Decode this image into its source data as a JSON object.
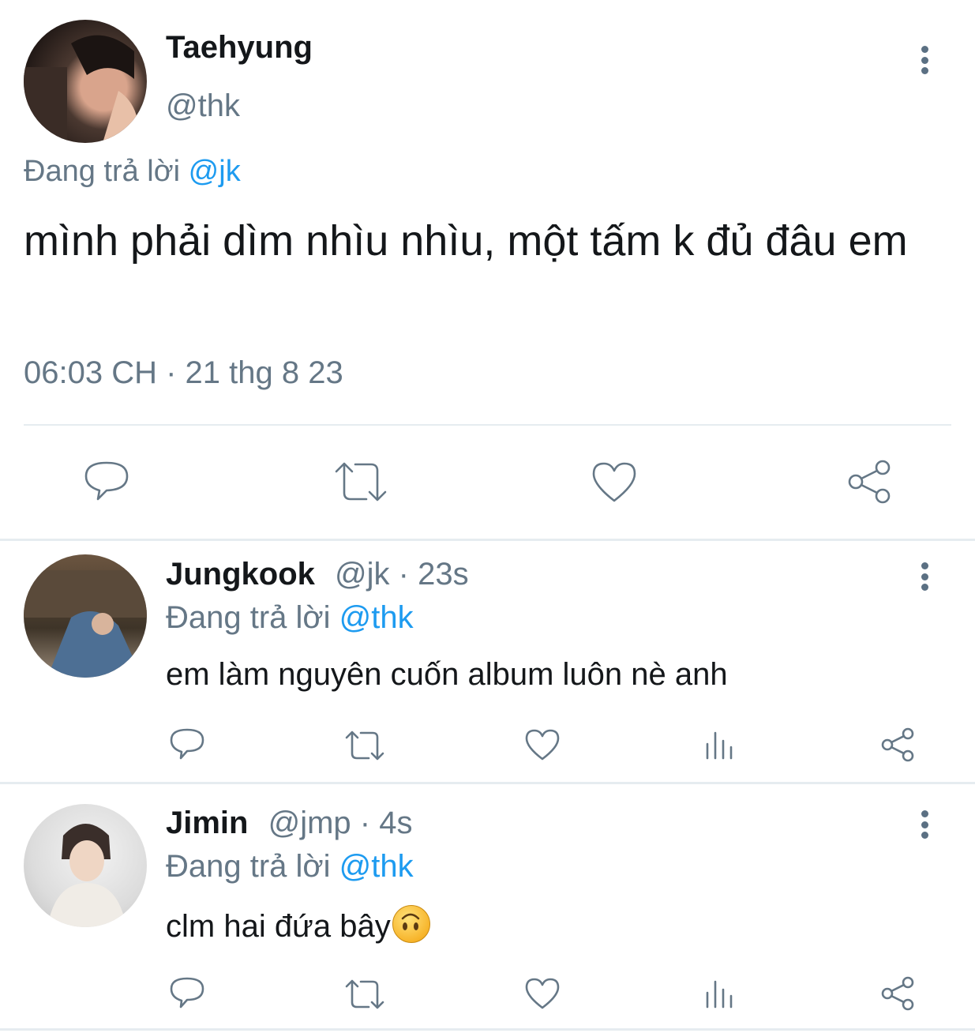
{
  "main_tweet": {
    "author_name": "Taehyung",
    "handle": "@thk",
    "reply_prefix": "Đang trả lời",
    "reply_to": "@jk",
    "text": "mình phải dìm nhìu nhìu, một tấm k đủ đâu em",
    "timestamp": "06:03 CH · 21 thg 8 23",
    "actions": [
      "reply-icon",
      "retweet-icon",
      "like-icon",
      "share-icon"
    ]
  },
  "replies": [
    {
      "author_name": "Jungkook",
      "handle": "@jk",
      "time": "· 23s",
      "reply_prefix": "Đang trả lời",
      "reply_to": "@thk",
      "text": "em làm nguyên cuốn album luôn nè anh"
    },
    {
      "author_name": "Jimin",
      "handle": "@jmp",
      "time": "· 4s",
      "reply_prefix": "Đang trả lời",
      "reply_to": "@thk",
      "text": "clm hai đứa bây",
      "emoji": "upside-down-face"
    }
  ],
  "colors": {
    "accent": "#1d9bf0",
    "muted": "#657786",
    "text": "#14171a",
    "divider": "#e6ecf0"
  }
}
